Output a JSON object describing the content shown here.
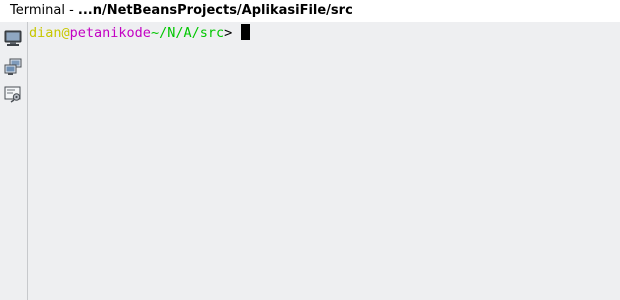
{
  "tab": {
    "prefix": "Terminal - ",
    "path": "...n/NetBeansProjects/AplikasiFile/src"
  },
  "toolbar": {
    "items": [
      {
        "icon": "monitor-icon"
      },
      {
        "icon": "connect-remote-icon"
      },
      {
        "icon": "terminal-options-icon"
      }
    ]
  },
  "terminal": {
    "user": "dian",
    "at": "@",
    "host": "petanikode",
    "path": "~/N/A/src",
    "prompt_char": "> ",
    "colors": {
      "user": "#c7c700",
      "at": "#c7c700",
      "host": "#c300c3",
      "path": "#00c700",
      "prompt": "#000000",
      "cursor": "#000000"
    }
  }
}
